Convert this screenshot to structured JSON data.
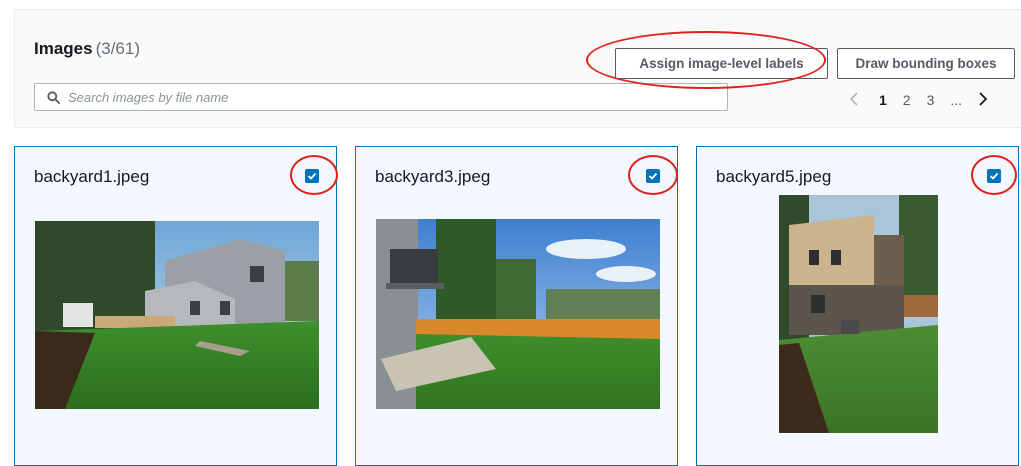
{
  "header": {
    "title": "Images",
    "count": "(3/61)",
    "assign_label": "Assign image-level labels",
    "draw_label": "Draw bounding boxes"
  },
  "search": {
    "placeholder": "Search images by file name",
    "icon": "search-icon"
  },
  "pagination": {
    "prev_icon": "chevron-left-icon",
    "pages": [
      "1",
      "2",
      "3"
    ],
    "current": "1",
    "ellipsis": "...",
    "next_icon": "chevron-right-icon"
  },
  "images": [
    {
      "file_name": "backyard1.jpeg",
      "checked": true
    },
    {
      "file_name": "backyard3.jpeg",
      "checked": true
    },
    {
      "file_name": "backyard5.jpeg",
      "checked": true
    }
  ],
  "colors": {
    "accent": "#0073bb",
    "annotation_ring": "#e0211b",
    "panel_bg": "#fafafa",
    "card_bg": "#f2f8fd"
  }
}
